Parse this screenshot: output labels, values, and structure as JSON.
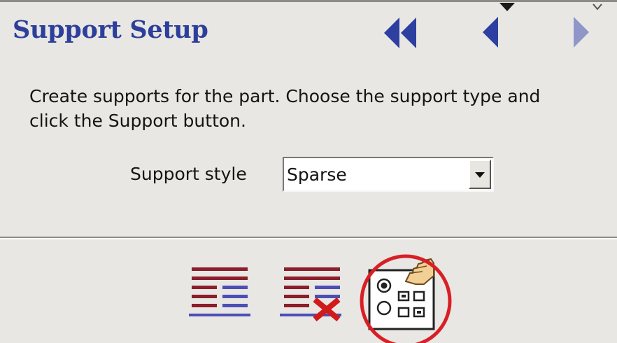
{
  "header": {
    "title": "Support Setup"
  },
  "navigation": {
    "first_icon": "double-left-arrow-icon",
    "previous_icon": "left-arrow-icon",
    "next_icon": "right-arrow-icon"
  },
  "instructions": "Create supports for the part. Choose the support type and click the Support button.",
  "support_style": {
    "label": "Support style",
    "selected": "Sparse",
    "dropdown_icon": "chevron-down-icon"
  },
  "toolbar": {
    "tools": [
      {
        "name": "support-layers-icon"
      },
      {
        "name": "remove-support-icon"
      },
      {
        "name": "support-button-icon",
        "highlighted": true
      }
    ]
  },
  "colors": {
    "title": "#2c3f9a",
    "nav_arrow": "#2d3fa0",
    "nav_arrow_disabled": "#8e97c8",
    "layer_red": "#8b1e2a",
    "layer_blue": "#4b4fb5",
    "delete_red": "#d11a1a",
    "highlight_circle": "#d81f26",
    "panel_background": "#e9e7e3"
  }
}
